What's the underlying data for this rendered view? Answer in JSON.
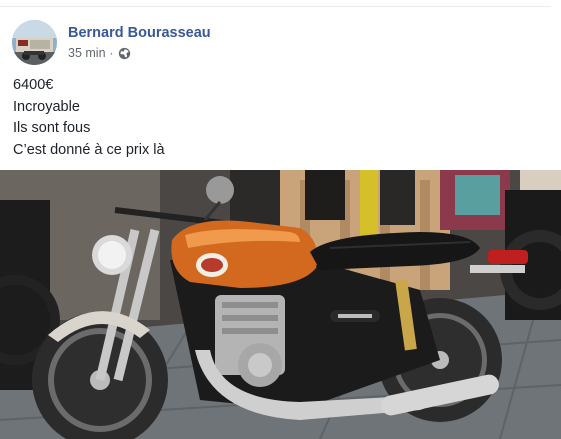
{
  "post": {
    "author": "Bernard Bourasseau",
    "timestamp": "35 min",
    "separator": "·",
    "privacy_icon": "globe-icon",
    "text_lines": [
      "6400€",
      "Incroyable",
      "Ils sont fous",
      "C’est donné à ce prix là"
    ],
    "photo_subject": "motorcycle-photo"
  },
  "colors": {
    "author_link": "#385898",
    "meta_text": "#616770",
    "body_text": "#1d2129",
    "divider": "#e9ebee",
    "tank_orange": "#d2691e"
  }
}
